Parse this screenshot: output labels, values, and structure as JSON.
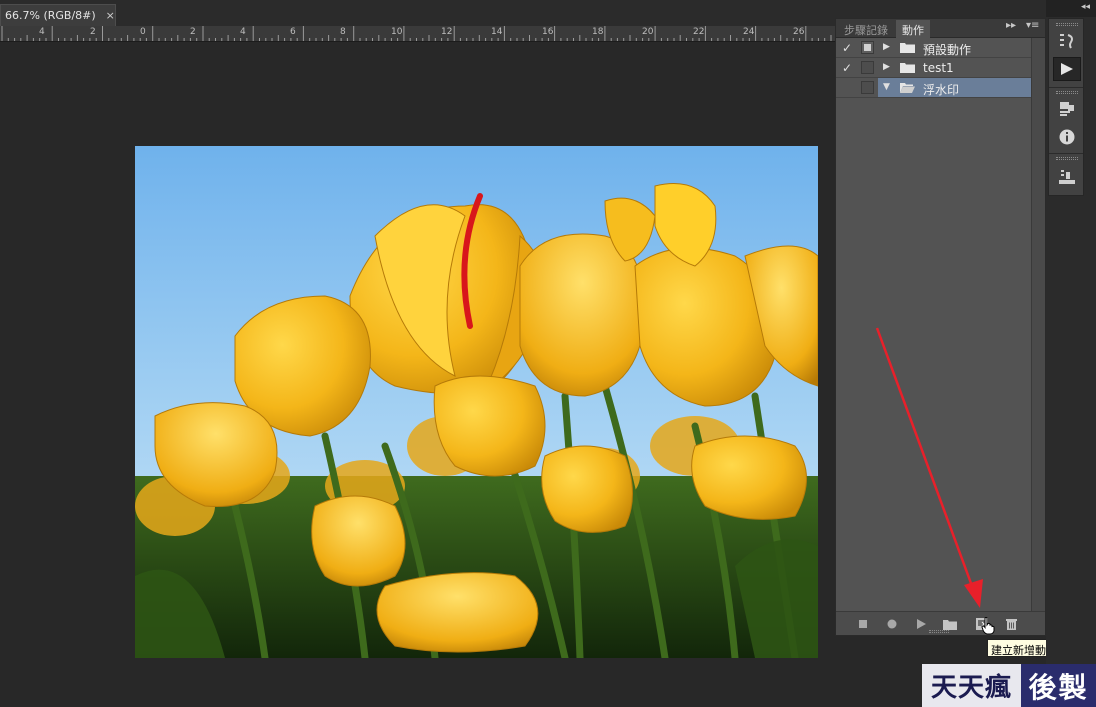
{
  "document": {
    "tab_label": "66.7% (RGB/8#)",
    "close_label": "×"
  },
  "ruler": {
    "ticks": [
      "4",
      "2",
      "0",
      "2",
      "4",
      "6",
      "8",
      "10",
      "12",
      "14",
      "16",
      "18",
      "20",
      "22",
      "24",
      "26"
    ]
  },
  "panel": {
    "tabs": [
      {
        "label": "步驟記錄",
        "active": false
      },
      {
        "label": "動作",
        "active": true
      }
    ],
    "expand_label": "▸▸",
    "menu_label": "▾≡",
    "actions": [
      {
        "checked": true,
        "dialog": true,
        "expanded": false,
        "name": "預設動作",
        "selected": false
      },
      {
        "checked": true,
        "dialog": false,
        "expanded": false,
        "name": "test1",
        "selected": false
      },
      {
        "checked": false,
        "dialog": false,
        "expanded": true,
        "name": "浮水印",
        "selected": true
      }
    ],
    "footer_buttons": [
      "stop-icon",
      "record-icon",
      "play-icon",
      "new-set-icon",
      "new-action-icon",
      "trash-icon"
    ]
  },
  "tooltip": {
    "text": "建立新增動作"
  },
  "dock": {
    "collapse_label": "◂◂",
    "buttons": [
      "history-brush-icon",
      "play-actions-icon",
      "properties-icon",
      "info-icon",
      "layer-comps-icon"
    ]
  },
  "watermark": {
    "left": "天天瘋",
    "right": "後製"
  },
  "colors": {
    "selection": "#6a7e99",
    "annotation_arrow": "#e8202a",
    "panel_bg": "#535353",
    "canvas_bg": "#282828"
  }
}
